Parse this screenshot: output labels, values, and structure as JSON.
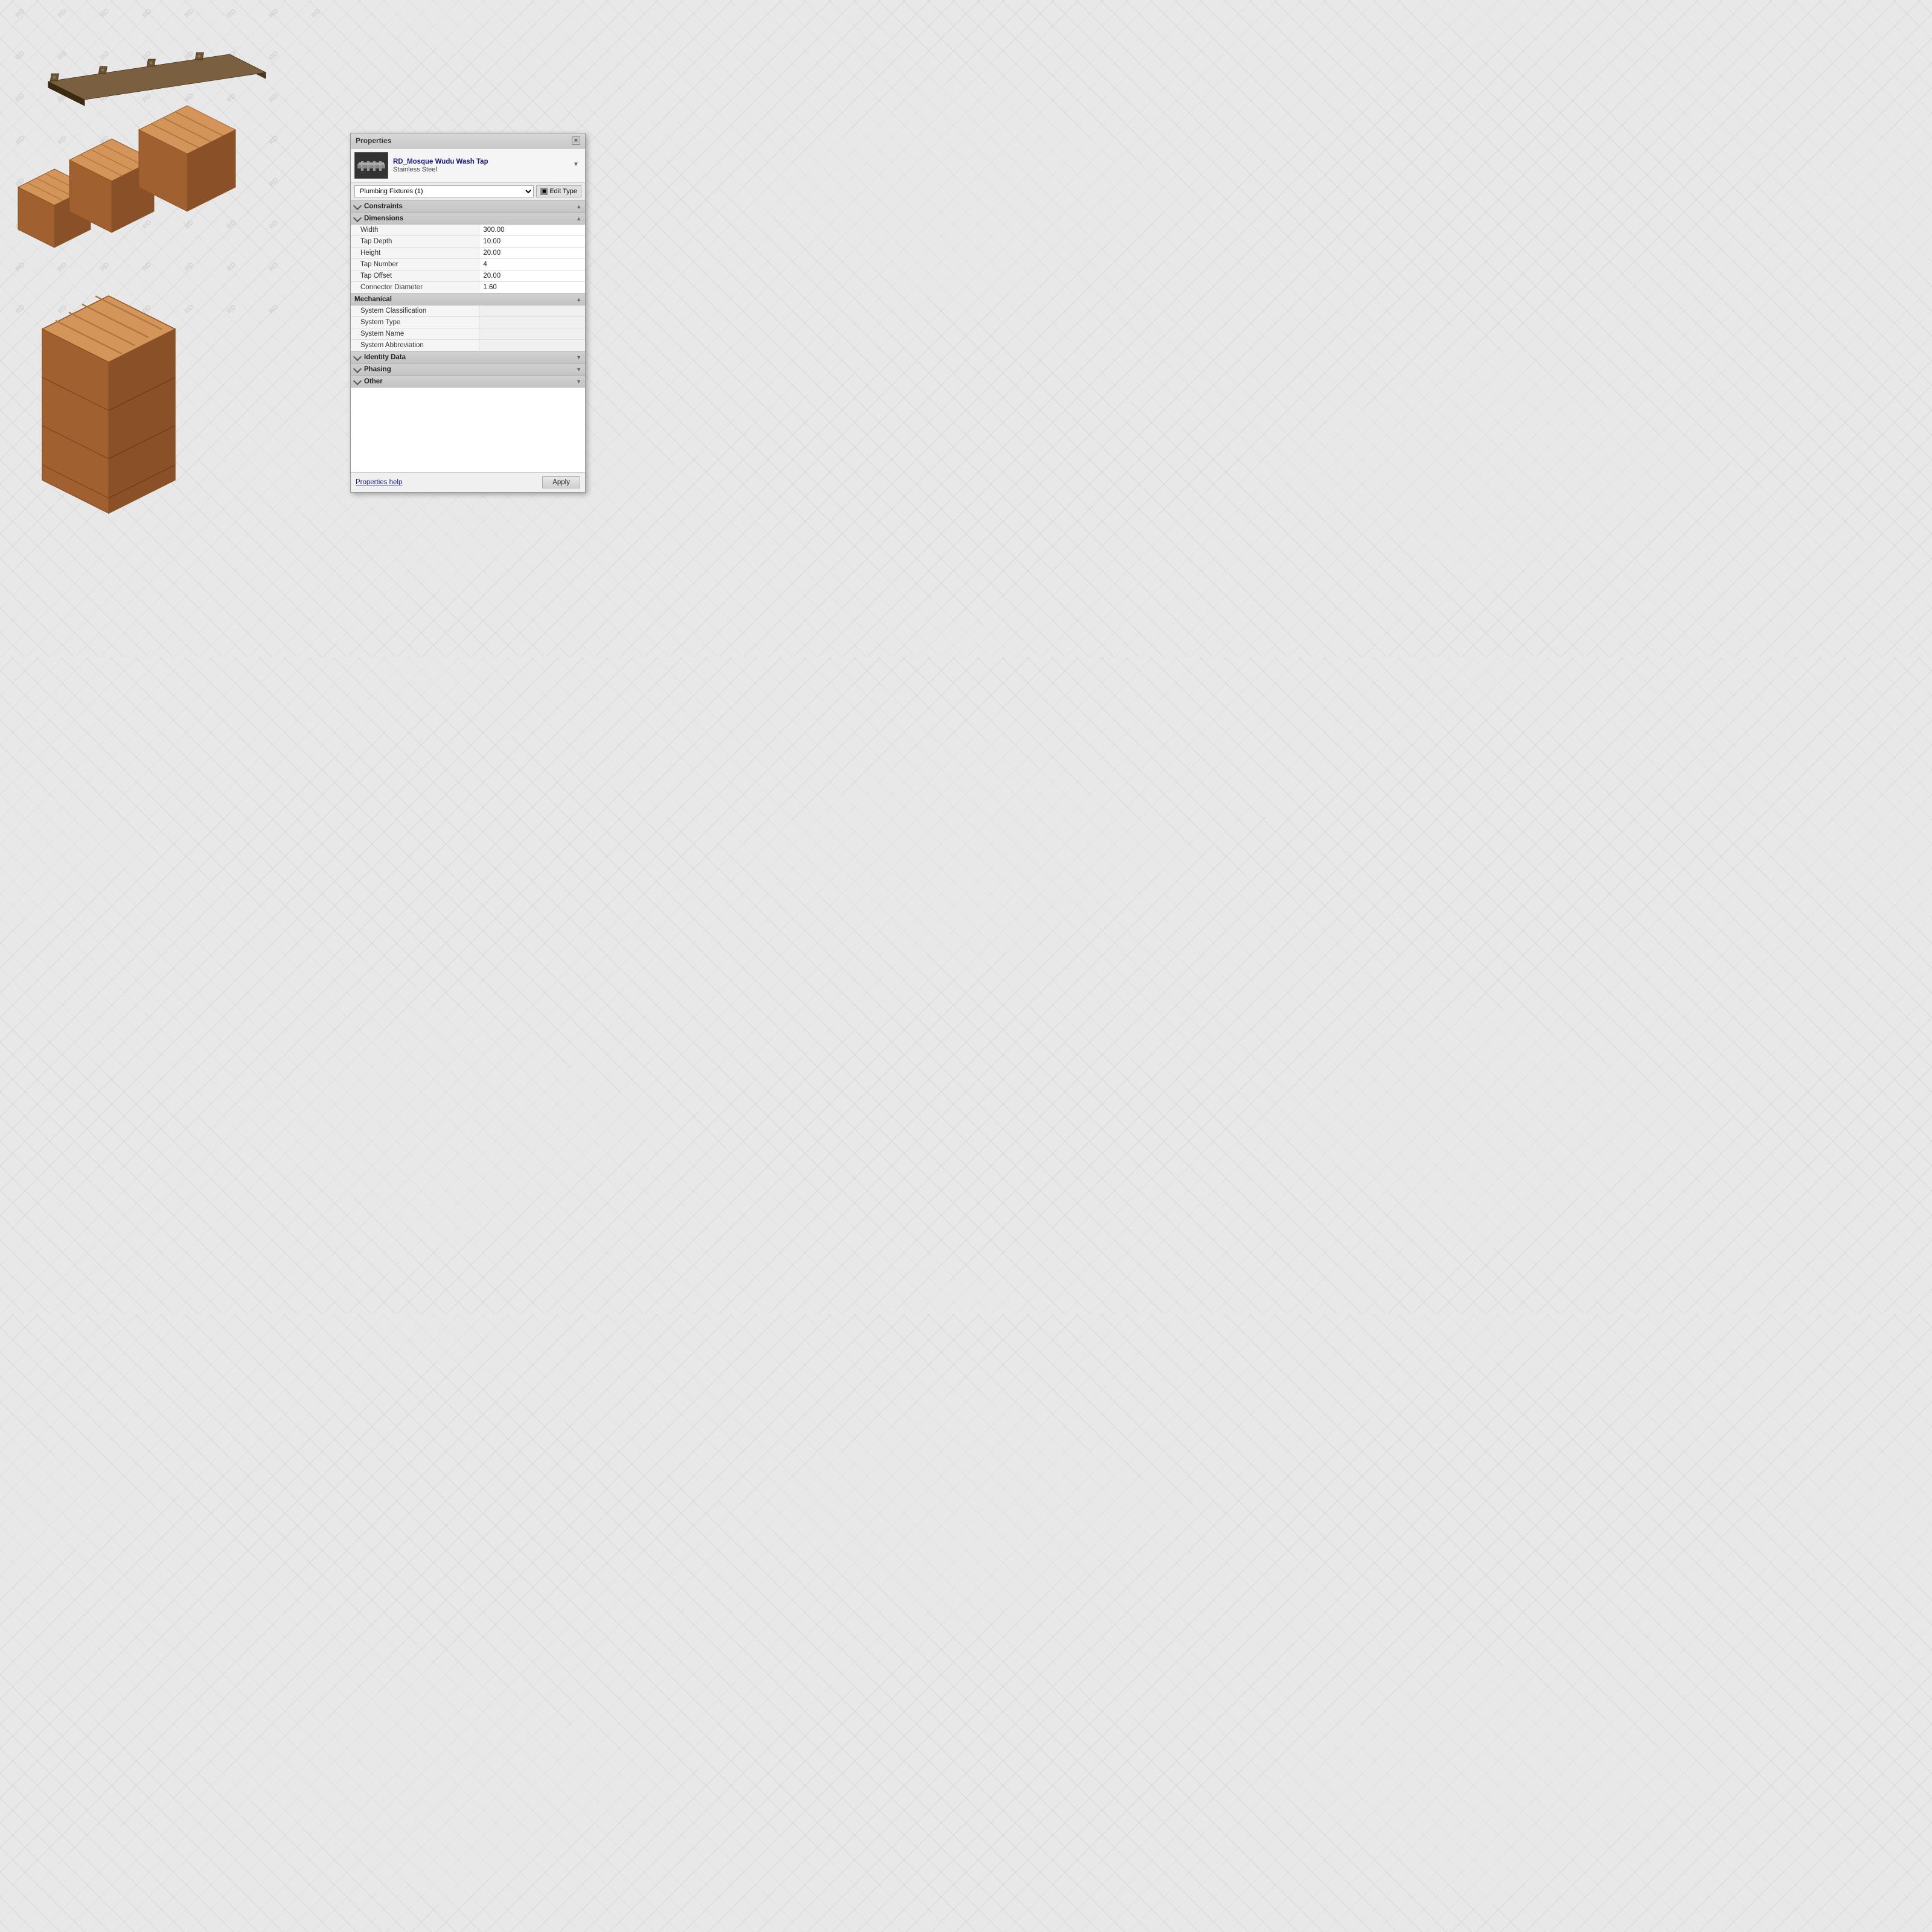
{
  "panel": {
    "title": "Properties",
    "close_label": "×",
    "header": {
      "title": "RD_Mosque Wudu Wash Tap",
      "subtitle": "Stainless Steel",
      "dropdown_symbol": "▼"
    },
    "selector": {
      "value": "Plumbing Fixtures (1)",
      "options": [
        "Plumbing Fixtures (1)"
      ]
    },
    "edit_type_label": "Edit Type",
    "sections": {
      "constraints": {
        "label": "Constraints"
      },
      "dimensions": {
        "label": "Dimensions",
        "properties": [
          {
            "label": "Width",
            "value": "300.00"
          },
          {
            "label": "Tap Depth",
            "value": "10.00"
          },
          {
            "label": "Height",
            "value": "20.00"
          },
          {
            "label": "Tap Number",
            "value": "4"
          },
          {
            "label": "Tap Offset",
            "value": "20.00"
          },
          {
            "label": "Connector Diameter",
            "value": "1.60"
          }
        ]
      },
      "mechanical": {
        "label": "Mechanical",
        "properties": [
          {
            "label": "System Classification",
            "value": ""
          },
          {
            "label": "System Type",
            "value": ""
          },
          {
            "label": "System Name",
            "value": ""
          },
          {
            "label": "System Abbreviation",
            "value": ""
          }
        ]
      },
      "identity_data": {
        "label": "Identity Data"
      },
      "phasing": {
        "label": "Phasing"
      },
      "other": {
        "label": "Other"
      }
    },
    "footer": {
      "help_link": "Properties help",
      "apply_label": "Apply"
    }
  },
  "watermark": {
    "text": "RD"
  },
  "scene": {
    "description": "3D isometric view with wooden box objects and wash tap rail"
  }
}
